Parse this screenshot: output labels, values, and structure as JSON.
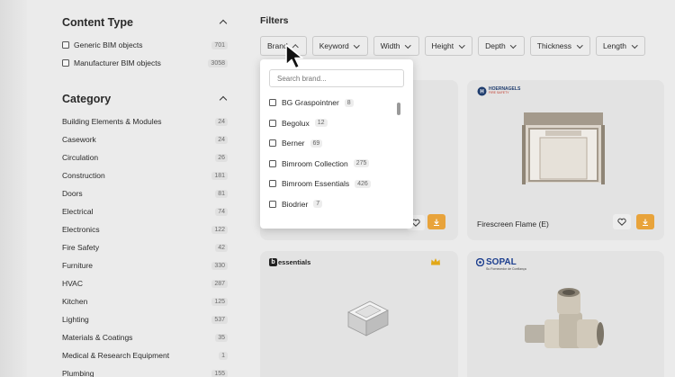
{
  "sidebar": {
    "content_type": {
      "title": "Content Type",
      "items": [
        {
          "label": "Generic BIM objects",
          "count": "701"
        },
        {
          "label": "Manufacturer BIM objects",
          "count": "3058"
        }
      ]
    },
    "category": {
      "title": "Category",
      "items": [
        {
          "label": "Building Elements & Modules",
          "count": "24"
        },
        {
          "label": "Casework",
          "count": "24"
        },
        {
          "label": "Circulation",
          "count": "26"
        },
        {
          "label": "Construction",
          "count": "181"
        },
        {
          "label": "Doors",
          "count": "81"
        },
        {
          "label": "Electrical",
          "count": "74"
        },
        {
          "label": "Electronics",
          "count": "122"
        },
        {
          "label": "Fire Safety",
          "count": "42"
        },
        {
          "label": "Furniture",
          "count": "330"
        },
        {
          "label": "HVAC",
          "count": "287"
        },
        {
          "label": "Kitchen",
          "count": "125"
        },
        {
          "label": "Lighting",
          "count": "537"
        },
        {
          "label": "Materials & Coatings",
          "count": "35"
        },
        {
          "label": "Medical & Research Equipment",
          "count": "1"
        },
        {
          "label": "Plumbing",
          "count": "155"
        }
      ]
    }
  },
  "filters": {
    "title": "Filters",
    "buttons": [
      "Brand",
      "Keyword",
      "Width",
      "Height",
      "Depth",
      "Thickness",
      "Length"
    ]
  },
  "brand_dropdown": {
    "search_placeholder": "Search brand...",
    "options": [
      {
        "label": "BG Graspointner",
        "count": "8"
      },
      {
        "label": "Begolux",
        "count": "12"
      },
      {
        "label": "Berner",
        "count": "69"
      },
      {
        "label": "Bimroom Collection",
        "count": "275"
      },
      {
        "label": "Bimroom Essentials",
        "count": "426"
      },
      {
        "label": "Biodrier",
        "count": "7"
      }
    ]
  },
  "cards": [
    {
      "brand": "HOERNAGELS",
      "brand_sub": "FIRE SAFETY",
      "title": "Firescreen Flame (E)"
    },
    {
      "brand": "essentials",
      "brand_prefix": "b",
      "title": ""
    },
    {
      "brand": "SOPAL",
      "brand_sub": "Su Fornecedor de Confiança",
      "title": ""
    }
  ],
  "colors": {
    "accent": "#e8a33b",
    "background": "#ebebeb",
    "card": "#e3e3e3",
    "premium_crown": "#e2a817"
  }
}
